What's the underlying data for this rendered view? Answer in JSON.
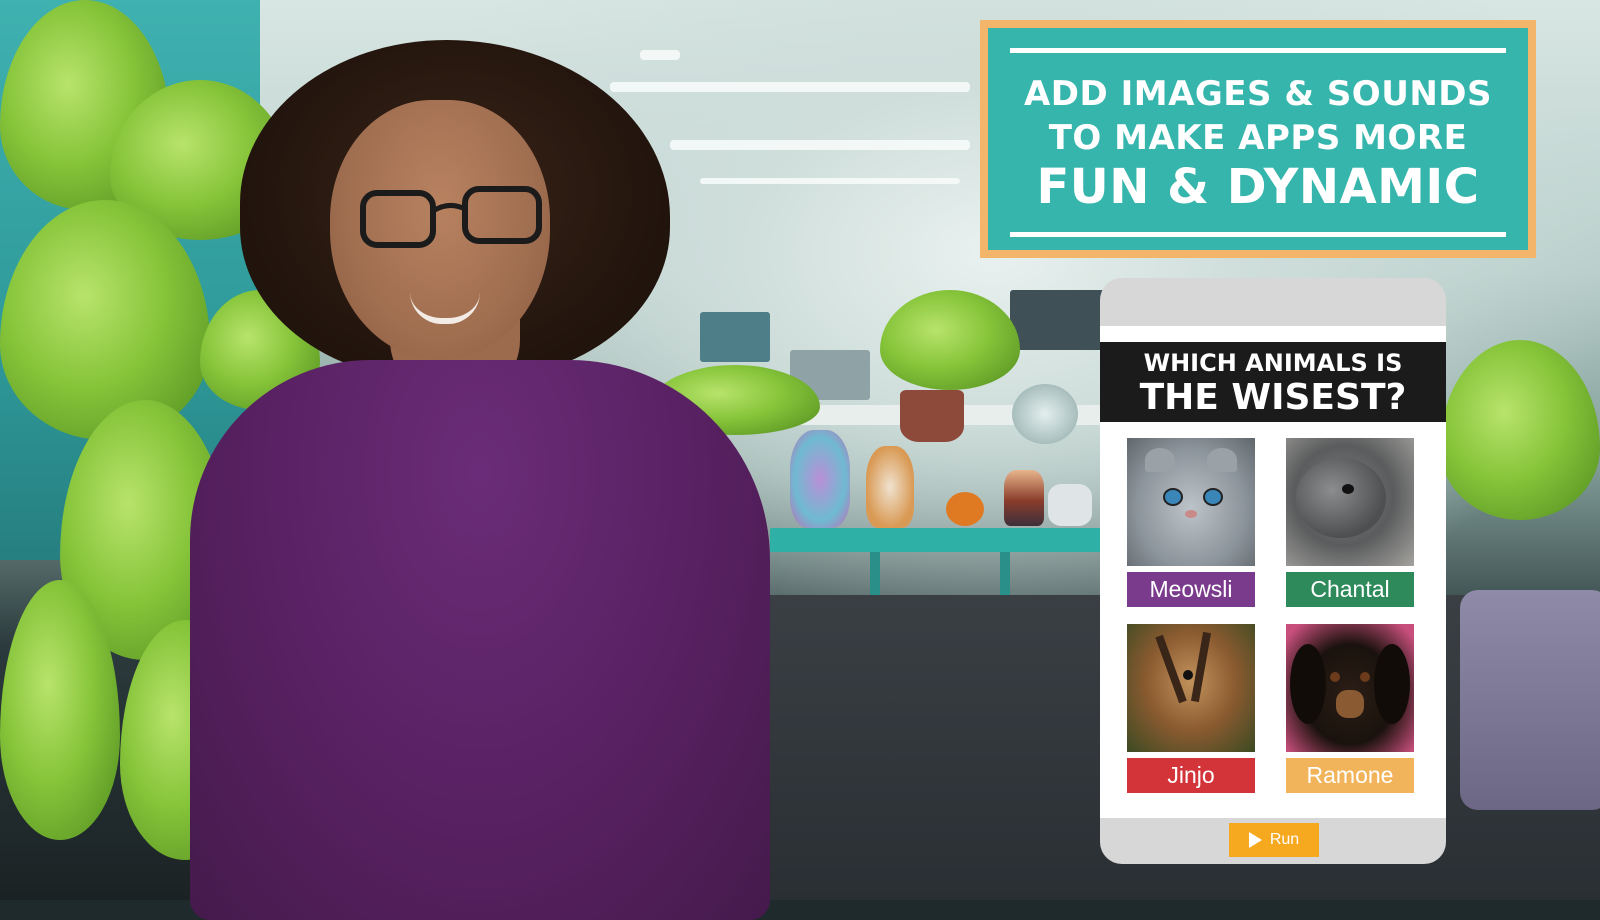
{
  "banner": {
    "line1": "ADD IMAGES & SOUNDS",
    "line2": "TO MAKE APPS MORE",
    "line3": "FUN & DYNAMIC",
    "colors": {
      "border": "#f2b56a",
      "fill": "#36b5ad",
      "text": "#ffffff"
    }
  },
  "app": {
    "question_line1": "WHICH ANIMALS IS",
    "question_line2": "THE WISEST?",
    "animals": [
      {
        "name": "Meowsli",
        "color": "#7b3b8c",
        "icon": "cat-photo"
      },
      {
        "name": "Chantal",
        "color": "#2e8a5a",
        "icon": "seal-photo"
      },
      {
        "name": "Jinjo",
        "color": "#d3343a",
        "icon": "chipmunk-photo"
      },
      {
        "name": "Ramone",
        "color": "#f2b45a",
        "icon": "dachshund-photo"
      }
    ],
    "run_label": "Run",
    "run_color": "#f6a81e"
  }
}
